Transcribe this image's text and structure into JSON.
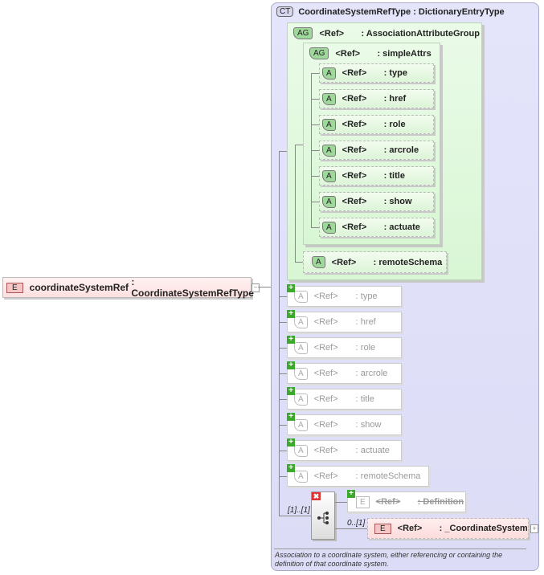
{
  "element": {
    "badge": "E",
    "name": "coordinateSystemRef",
    "type": ": CoordinateSystemRefType",
    "toggle": "−"
  },
  "complex_type": {
    "badge": "CT",
    "name": "CoordinateSystemRefType",
    "base": ": DictionaryEntryType"
  },
  "ref_label": "<Ref>",
  "attr_group": {
    "badge": "AG",
    "name": ": AssociationAttributeGroup"
  },
  "simple_attrs": {
    "badge": "AG",
    "name": ": simpleAttrs"
  },
  "attr_badge": "A",
  "attrs": [
    ": type",
    ": href",
    ": role",
    ": arcrole",
    ": title",
    ": show",
    ": actuate"
  ],
  "remote_schema": ": remoteSchema",
  "inherited_attrs": [
    ": type",
    ": href",
    ": role",
    ": arcrole",
    ": title",
    ": show",
    ": actuate",
    ": remoteSchema"
  ],
  "choice": {
    "multiplicity": "[1]..[1]"
  },
  "definition": {
    "badge": "E",
    "name": ": Definition"
  },
  "coordinate_system": {
    "badge": "E",
    "name": ": _CoordinateSystem",
    "multiplicity": "0..[1]",
    "toggle": "+"
  },
  "description": "Association to a coordinate system, either referencing or containing the definition of that coordinate system."
}
